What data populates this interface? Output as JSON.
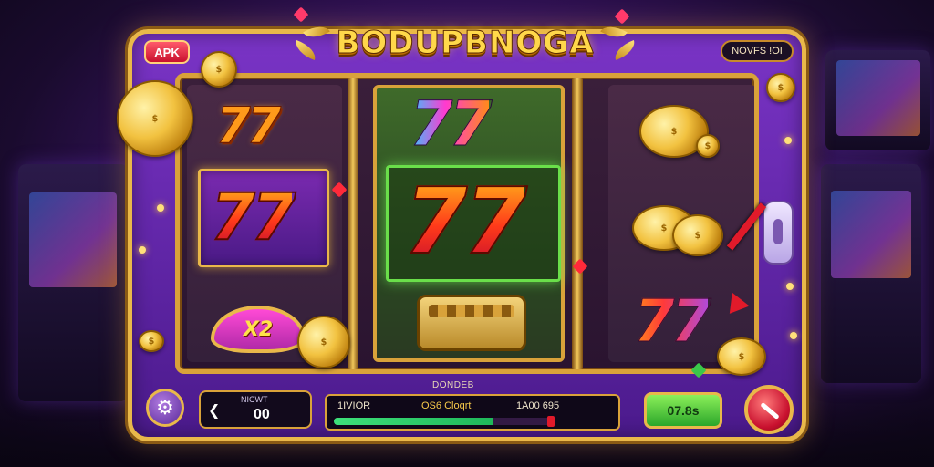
{
  "title": "BODUPBNOGA",
  "apk_badge": "APK",
  "top_right_badge": "NOVFS !OI",
  "bonus_badge": "X2",
  "controls": {
    "bet_label": "NICWT",
    "bet_value": "00",
    "progress_heading": "DONDEB",
    "progress_left": "1IVIOR",
    "progress_mid": "OS6 Cloqrt",
    "progress_right": "1A00 695",
    "progress_fraction": 0.72,
    "spin_label": "07.8s"
  },
  "symbols": {
    "seven": "77"
  },
  "colors": {
    "frame_gold": "#e9b84a",
    "machine_purple": "#7a34c6",
    "win_green": "#6adf4a",
    "spin_green": "#2aa62a",
    "stop_red": "#c8102e"
  }
}
